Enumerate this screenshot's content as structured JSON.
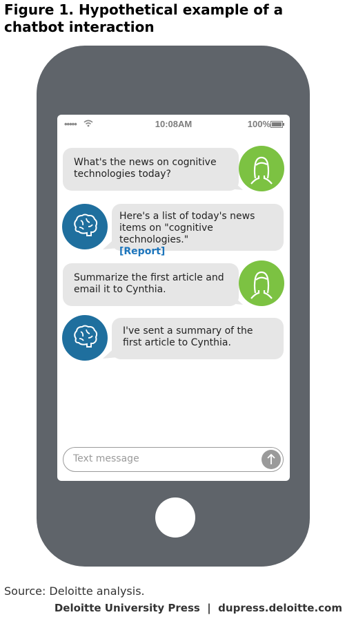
{
  "figure": {
    "title": "Figure 1. Hypothetical example of a chatbot interaction"
  },
  "phone": {
    "status": {
      "signal": "•••••",
      "time": "10:08AM",
      "battery": "100%"
    },
    "messages": [
      {
        "sender": "user",
        "text": "What's the news on cognitive technologies today?"
      },
      {
        "sender": "bot",
        "text": "Here's a list of today's news items on \"cognitive technologies.\"",
        "link": "[Report]"
      },
      {
        "sender": "user",
        "text": "Summarize the first article and email it to Cynthia."
      },
      {
        "sender": "bot",
        "text": "I've sent a summary of the first article to Cynthia."
      }
    ],
    "input": {
      "placeholder": "Text message"
    }
  },
  "source": "Source: Deloitte analysis.",
  "credit": "Deloitte University Press  |  dupress.deloitte.com",
  "colors": {
    "phone_body": "#5f646a",
    "user_avatar": "#7cc242",
    "bot_avatar": "#1f6f9e",
    "bubble": "#e6e6e6",
    "link": "#1c75bc"
  }
}
